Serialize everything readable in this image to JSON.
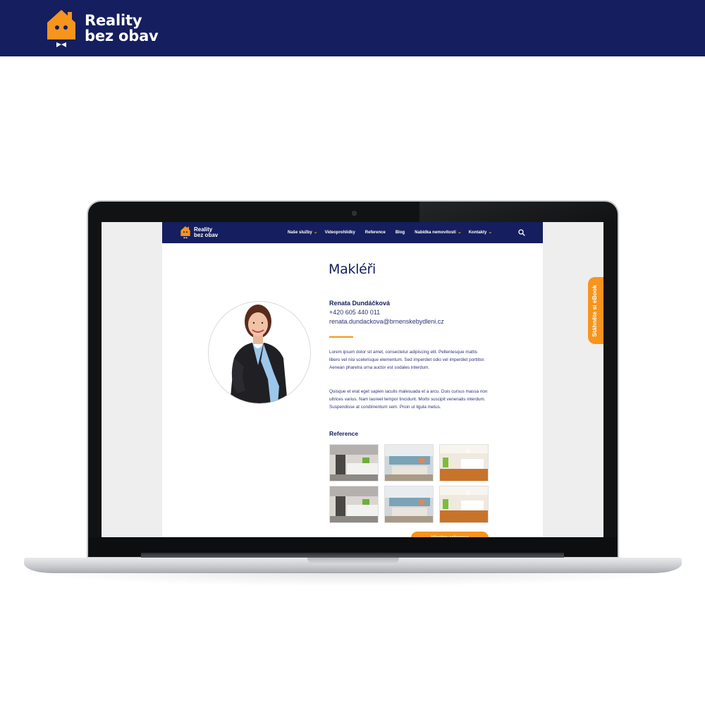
{
  "banner": {
    "logo_line1": "Reality",
    "logo_line2": "bez obav",
    "logo_icon": "house-mascot-icon"
  },
  "site": {
    "logo_line1": "Reality",
    "logo_line2": "bez obav",
    "nav": [
      {
        "label": "Naše služby",
        "dropdown": true
      },
      {
        "label": "Videoprohlídky",
        "dropdown": false
      },
      {
        "label": "Reference",
        "dropdown": false
      },
      {
        "label": "Blog",
        "dropdown": false
      },
      {
        "label": "Nabídka nemovitostí",
        "dropdown": true
      },
      {
        "label": "Kontakty",
        "dropdown": true
      }
    ],
    "search_icon": "search-icon",
    "page_title": "Makléři",
    "agent": {
      "name": "Renata Dundáčková",
      "phone": "+420 605 440 011",
      "email": "renata.dundackova@brnenskebydleni.cz"
    },
    "bio_paragraph_1": "Lorem ipsum dolor sit amet, consectetur adipiscing elit. Pellentesque mattis libero vel nisi scelerisque elementum. Sed imperdiet odio vel imperdiet porttitor. Aenean pharetra urna auctor est sodales interdum.",
    "bio_paragraph_2": "Quisque et erat eget sapien iaculis malesuada et a arcu. Duis cursus massa non ultrices varius. Nam laoreet tempor tincidunt. Morbi suscipit venenatis interdum. Suspendisse at condimentum sem. Proin ut ligula metus.",
    "reference_heading": "Reference",
    "cta_label": "Všechny reference"
  },
  "ebook_tab": {
    "label": "Stáhněte si eBook"
  },
  "colors": {
    "navy": "#151e5e",
    "orange": "#f7941d"
  }
}
